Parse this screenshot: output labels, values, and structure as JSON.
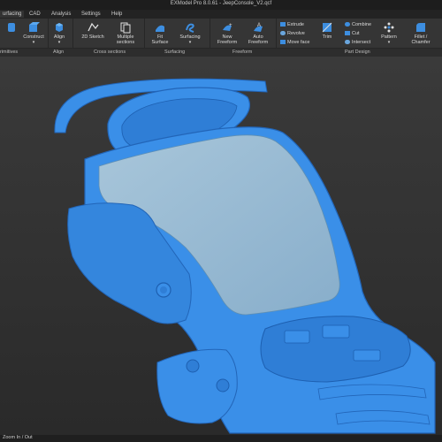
{
  "window": {
    "title": "EXModel Pro 8.0.61 - JeepConsole_V2.qcf"
  },
  "menu": [
    "urfacing",
    "CAD",
    "Analysis",
    "Settings",
    "Help"
  ],
  "ribbon": {
    "buttons": {
      "construct": "Construct",
      "align": "Align",
      "sketch2d": "2D Sketch",
      "multiple_sections": "Multiple sections",
      "fit_surface": "Fit Surface",
      "surfacing": "Surfacing",
      "new_freeform": "New Freeform",
      "auto_freeform": "Auto Freeform",
      "extrude": "Extrude",
      "revolve": "Revolve",
      "move_face": "Move face",
      "trim": "Trim",
      "combine": "Combine",
      "cut": "Cut",
      "intersect": "Intersect",
      "pattern": "Pattern",
      "fillet_chamfer": "Fillet / Chamfer"
    },
    "groups": {
      "primitives": "rimitives",
      "align": "Align",
      "cross_sections": "Cross sections",
      "surfacing": "Surfacing",
      "freeform": "Freeform",
      "part_design": "Part Design"
    }
  },
  "status": {
    "text": "Zoom In / Out"
  },
  "colors": {
    "mesh": "#3a8fe8",
    "mesh_shadow": "#2265b8",
    "surface": "#9bbfd6",
    "accent": "#4aa3ff"
  }
}
